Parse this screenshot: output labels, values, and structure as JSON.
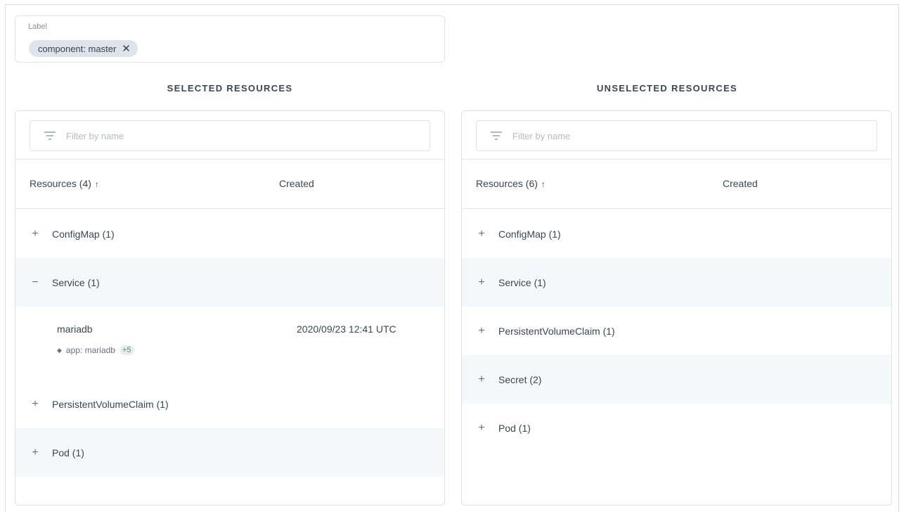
{
  "label_filter": {
    "title": "Label",
    "chip_text": "component: master",
    "chip_remove": "✕"
  },
  "selected": {
    "heading": "SELECTED RESOURCES",
    "filter_placeholder": "Filter by name",
    "col_resources": "Resources (4)",
    "col_created": "Created",
    "sort_arrow": "↑",
    "rows": [
      {
        "toggle": "+",
        "label": "ConfigMap (1)"
      },
      {
        "toggle": "−",
        "label": "Service (1)"
      },
      {
        "toggle": "+",
        "label": "PersistentVolumeClaim (1)"
      },
      {
        "toggle": "+",
        "label": "Pod (1)"
      }
    ],
    "expanded": {
      "name": "mariadb",
      "created": "2020/09/23 12:41 UTC",
      "tag_icon": "tag-icon",
      "tag": "app: mariadb",
      "more": "+5"
    }
  },
  "unselected": {
    "heading": "UNSELECTED RESOURCES",
    "filter_placeholder": "Filter by name",
    "col_resources": "Resources (6)",
    "col_created": "Created",
    "sort_arrow": "↑",
    "rows": [
      {
        "toggle": "+",
        "label": "ConfigMap (1)"
      },
      {
        "toggle": "+",
        "label": "Service (1)"
      },
      {
        "toggle": "+",
        "label": "PersistentVolumeClaim (1)"
      },
      {
        "toggle": "+",
        "label": "Secret (2)"
      },
      {
        "toggle": "+",
        "label": "Pod (1)"
      }
    ]
  },
  "icons": {
    "filter": "filter-icon",
    "sort": "sort-arrow-icon",
    "expand": "plus-icon",
    "collapse": "minus-icon"
  }
}
